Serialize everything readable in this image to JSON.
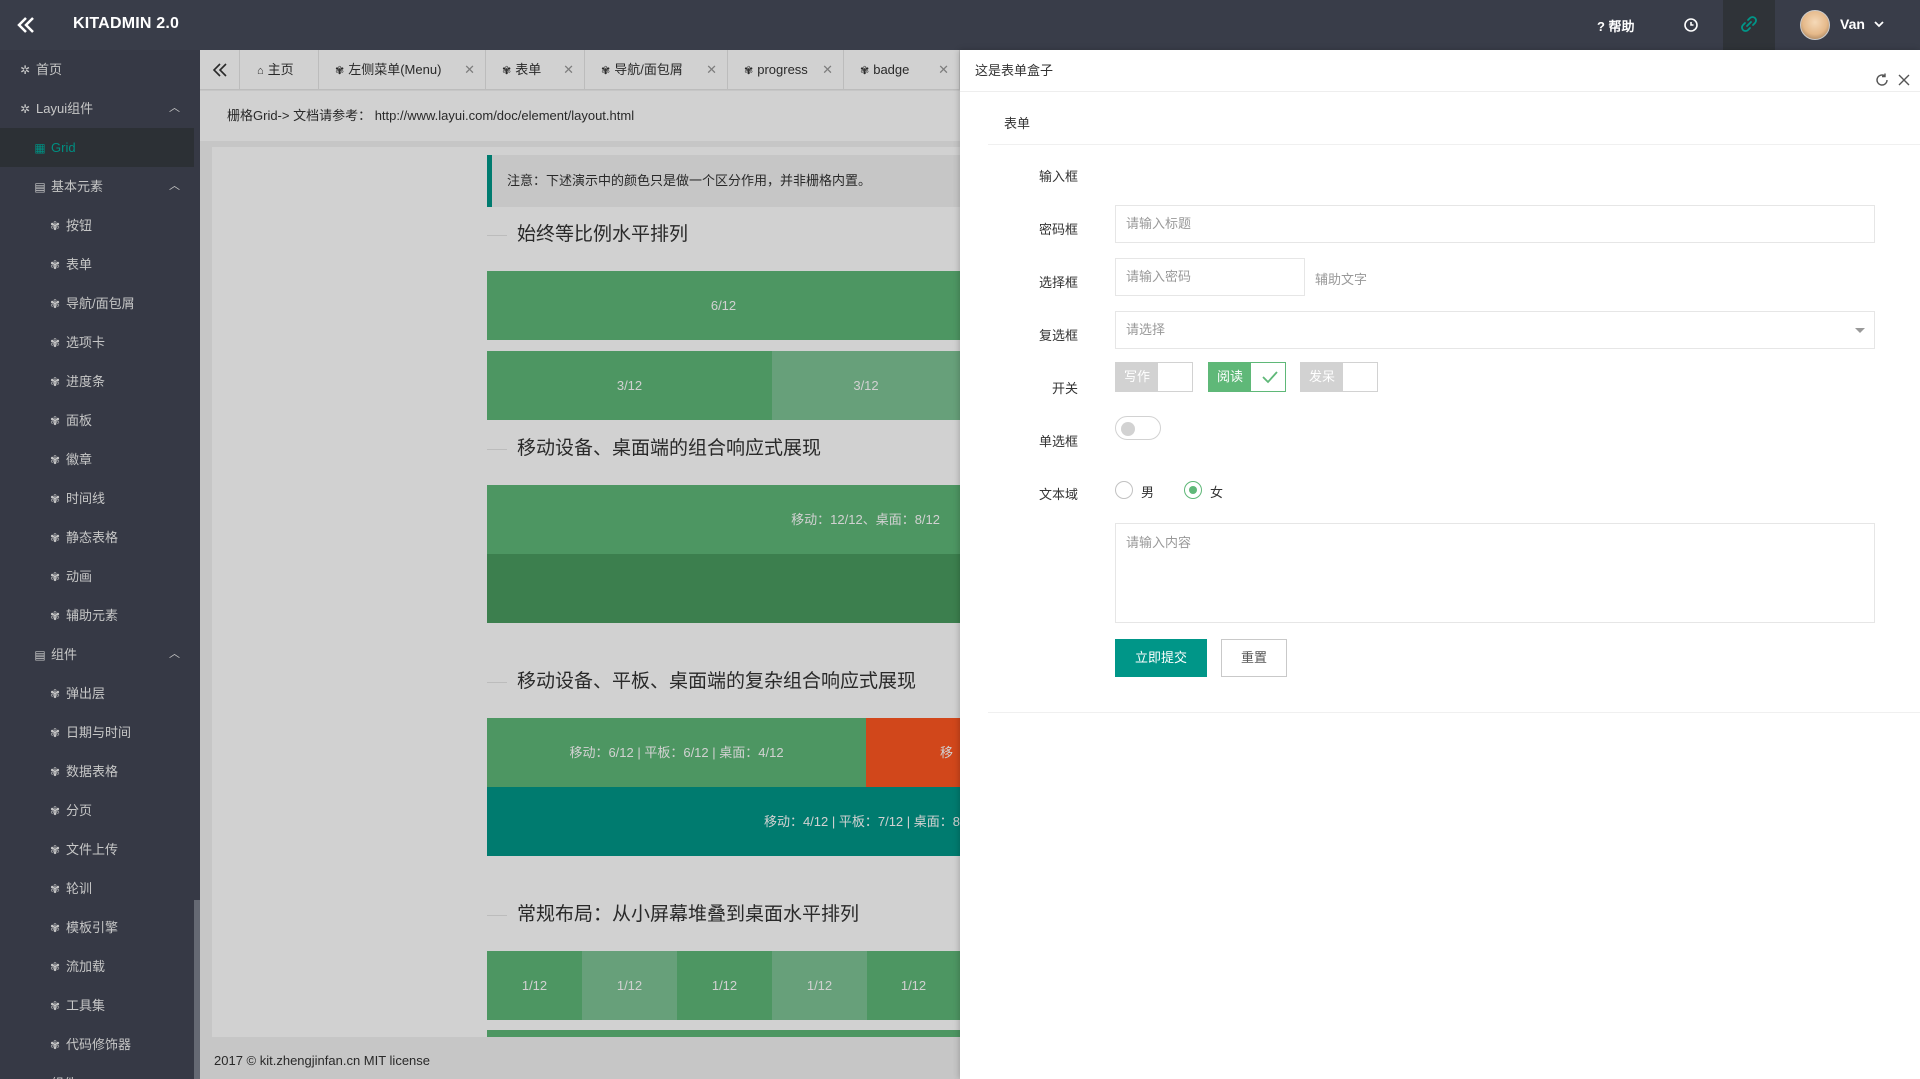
{
  "header": {
    "logo": "KITADMIN 2.0",
    "help": "? 帮助",
    "user_name": "Van"
  },
  "sidebar": {
    "items": [
      {
        "label": "首页",
        "icon": "gear-icon"
      },
      {
        "label": "Layui组件",
        "icon": "gear-icon"
      },
      {
        "label": "Grid",
        "icon": "grid-icon"
      },
      {
        "label": "基本元素",
        "icon": "doc-icon"
      },
      {
        "label": "按钮",
        "icon": "tree-icon"
      },
      {
        "label": "表单",
        "icon": "tree-icon"
      },
      {
        "label": "导航/面包屑",
        "icon": "tree-icon"
      },
      {
        "label": "选项卡",
        "icon": "tree-icon"
      },
      {
        "label": "进度条",
        "icon": "tree-icon"
      },
      {
        "label": "面板",
        "icon": "tree-icon"
      },
      {
        "label": "徽章",
        "icon": "tree-icon"
      },
      {
        "label": "时间线",
        "icon": "tree-icon"
      },
      {
        "label": "静态表格",
        "icon": "tree-icon"
      },
      {
        "label": "动画",
        "icon": "tree-icon"
      },
      {
        "label": "辅助元素",
        "icon": "tree-icon"
      },
      {
        "label": "组件",
        "icon": "doc-icon"
      },
      {
        "label": "弹出层",
        "icon": "tree-icon"
      },
      {
        "label": "日期与时间",
        "icon": "tree-icon"
      },
      {
        "label": "数据表格",
        "icon": "tree-icon"
      },
      {
        "label": "分页",
        "icon": "tree-icon"
      },
      {
        "label": "文件上传",
        "icon": "tree-icon"
      },
      {
        "label": "轮训",
        "icon": "tree-icon"
      },
      {
        "label": "模板引擎",
        "icon": "tree-icon"
      },
      {
        "label": "流加载",
        "icon": "tree-icon"
      },
      {
        "label": "工具集",
        "icon": "tree-icon"
      },
      {
        "label": "代码修饰器",
        "icon": "tree-icon"
      },
      {
        "label": "组件",
        "icon": "doc-icon"
      }
    ]
  },
  "tabs": [
    {
      "label": "主页"
    },
    {
      "label": "左侧菜单(Menu)"
    },
    {
      "label": "表单"
    },
    {
      "label": "导航/面包屑"
    },
    {
      "label": "progress"
    },
    {
      "label": "badge"
    }
  ],
  "main": {
    "doc_ref": "栅格Grid-> 文档请参考：  http://www.layui.com/doc/element/layout.html",
    "note": "注意：下述演示中的颜色只是做一个区分作用，并非栅格内置。",
    "sections": [
      {
        "title": "始终等比例水平排列"
      },
      {
        "title": "移动设备、桌面端的组合响应式展现"
      },
      {
        "title": "移动设备、平板、桌面端的复杂组合响应式展现"
      },
      {
        "title": "常规布局：从小屏幕堆叠到桌面水平排列"
      }
    ],
    "blocks": {
      "b1": "6/12",
      "b2": "3/12",
      "b3": "3/12",
      "b4": "移动：12/12、桌面：8/12",
      "b5": "移动：6/12 | 平板：6/12 | 桌面：4/12",
      "b6": "移动",
      "b7": "移动：4/12 | 平板：7/12 | 桌面：8",
      "small": [
        "1/12",
        "1/12",
        "1/12",
        "1/12",
        "1/12"
      ]
    },
    "footer": "2017 © kit.zhengjinfan.cn MIT license"
  },
  "drawer": {
    "title": "这是表单盒子",
    "card_title": "表单",
    "fields": {
      "input_label": "输入框",
      "input_placeholder": "请输入标题",
      "password_label": "密码框",
      "password_placeholder": "请输入密码",
      "aux_text": "辅助文字",
      "select_label": "选择框",
      "select_placeholder": "请选择",
      "checkbox_label": "复选框",
      "checkboxes": [
        {
          "label": "写作",
          "checked": false
        },
        {
          "label": "阅读",
          "checked": true
        },
        {
          "label": "发呆",
          "checked": false
        }
      ],
      "switch_label": "开关",
      "switch_on": false,
      "radio_label": "单选框",
      "radios": [
        {
          "label": "男",
          "checked": false
        },
        {
          "label": "女",
          "checked": true
        }
      ],
      "textarea_label": "文本域",
      "textarea_placeholder": "请输入内容"
    },
    "submit": "立即提交",
    "reset": "重置"
  },
  "colors": {
    "header_bg": "#393D49",
    "primary": "#009688",
    "green": "#5FB878",
    "orange": "#FF5722",
    "teal": "#009688"
  }
}
